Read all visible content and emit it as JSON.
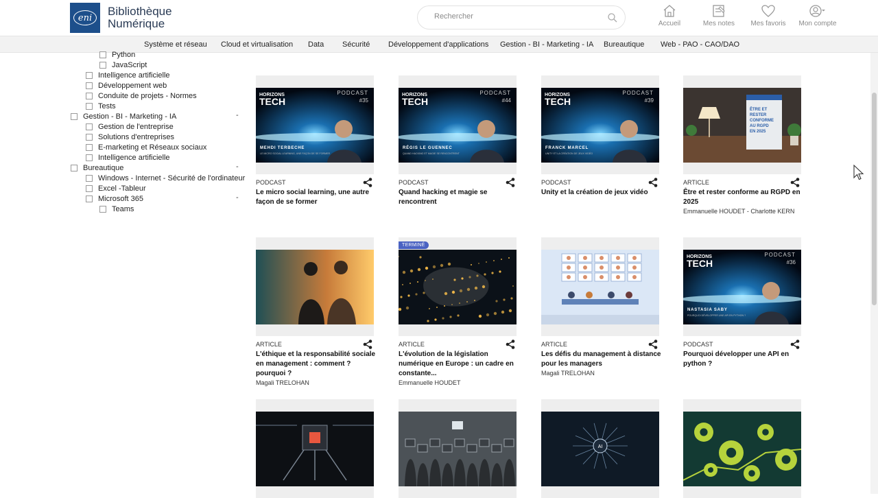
{
  "brand": {
    "logo_text": "eni",
    "line1": "Bibliothèque",
    "line2": "Numérique"
  },
  "search": {
    "placeholder": "Rechercher"
  },
  "nav": [
    {
      "label": "Accueil",
      "icon": "home-icon"
    },
    {
      "label": "Mes notes",
      "icon": "notes-icon"
    },
    {
      "label": "Mes favoris",
      "icon": "heart-icon"
    },
    {
      "label": "Mon compte",
      "icon": "account-icon"
    }
  ],
  "categories": [
    "Système et réseau",
    "Cloud et virtualisation",
    "Data",
    "Sécurité",
    "Développement d'applications",
    "Gestion - BI - Marketing - IA",
    "Bureautique",
    "Web - PAO - CAO/DAO"
  ],
  "sidebar": {
    "items": [
      {
        "label": "Python",
        "level": 2,
        "collapsible": false
      },
      {
        "label": "JavaScript",
        "level": 2,
        "collapsible": false
      },
      {
        "label": "Intelligence artificielle",
        "level": 1,
        "collapsible": false
      },
      {
        "label": "Développement web",
        "level": 1,
        "collapsible": false
      },
      {
        "label": "Conduite de projets - Normes",
        "level": 1,
        "collapsible": false
      },
      {
        "label": "Tests",
        "level": 1,
        "collapsible": false
      },
      {
        "label": "Gestion - BI - Marketing - IA",
        "level": 0,
        "collapsible": true
      },
      {
        "label": "Gestion de l'entreprise",
        "level": 1,
        "collapsible": false
      },
      {
        "label": "Solutions d'entreprises",
        "level": 1,
        "collapsible": false
      },
      {
        "label": "E-marketing et Réseaux sociaux",
        "level": 1,
        "collapsible": false
      },
      {
        "label": "Intelligence artificielle",
        "level": 1,
        "collapsible": false
      },
      {
        "label": "Bureautique",
        "level": 0,
        "collapsible": true
      },
      {
        "label": "Windows - Internet - Sécurité de l'ordinateur",
        "level": 1,
        "collapsible": false
      },
      {
        "label": "Excel -Tableur",
        "level": 1,
        "collapsible": false
      },
      {
        "label": "Microsoft 365",
        "level": 1,
        "collapsible": true
      },
      {
        "label": "Teams",
        "level": 2,
        "collapsible": false
      }
    ],
    "collapse_symbol": "-"
  },
  "cards": [
    {
      "type": "PODCAST",
      "title": "Le micro social learning, une autre façon de se former",
      "author": "",
      "badge": "",
      "thumb": "podcast",
      "episode": "#35",
      "guest": "MEHDI TERBECHE",
      "subtitle": "LE MICRO SOCIAL LEARNING, UNE FAÇON DE SE FORMER"
    },
    {
      "type": "PODCAST",
      "title": "Quand hacking et magie se rencontrent",
      "author": "",
      "badge": "",
      "thumb": "podcast",
      "episode": "#44",
      "guest": "RÉGIS LE GUENNEC",
      "subtitle": "QUAND HACKING ET MAGIE SE RENCONTRENT"
    },
    {
      "type": "PODCAST",
      "title": "Unity et la création de jeux vidéo",
      "author": "",
      "badge": "",
      "thumb": "podcast",
      "episode": "#39",
      "guest": "FRANCK MARCEL",
      "subtitle": "UNITY ET LA CRÉATION DE JEUX VIDÉO"
    },
    {
      "type": "ARTICLE",
      "title": "Être et rester conforme au RGPD en 2025",
      "author": "Emmanuelle HOUDET - Charlotte KERN",
      "badge": "",
      "thumb": "rgpd",
      "book_text": "ÊTRE ET RESTER CONFORME AU RGPD EN 2025"
    },
    {
      "type": "ARTICLE",
      "title": "L'éthique et la responsabilité sociale en management : comment ? pourquoi ?",
      "author": "Magali TRELOHAN",
      "badge": "",
      "thumb": "sunset"
    },
    {
      "type": "ARTICLE",
      "title": "L'évolution de la législation numérique en Europe : un cadre en constante...",
      "author": "Emmanuelle HOUDET",
      "badge": "TERMINÉ",
      "thumb": "europe"
    },
    {
      "type": "ARTICLE",
      "title": "Les défis du management à distance pour les managers",
      "author": "Magali TRELOHAN",
      "badge": "",
      "thumb": "remote"
    },
    {
      "type": "PODCAST",
      "title": "Pourquoi développer une API en python ?",
      "author": "",
      "badge": "",
      "thumb": "podcast",
      "episode": "#36",
      "guest": "NASTASIA SABY",
      "subtitle": "POURQUOI DÉVELOPPER UNE API EN PYTHON ?"
    },
    {
      "type": "",
      "title": "",
      "author": "",
      "badge": "",
      "thumb": "chip"
    },
    {
      "type": "",
      "title": "",
      "author": "",
      "badge": "",
      "thumb": "robots"
    },
    {
      "type": "",
      "title": "",
      "author": "",
      "badge": "",
      "thumb": "ai",
      "chip_text": "AI"
    },
    {
      "type": "",
      "title": "",
      "author": "",
      "badge": "",
      "thumb": "gears"
    }
  ],
  "podcast_brand": {
    "line1": "HORIZONS",
    "line2": "TECH",
    "label": "PODCAST"
  },
  "colors": {
    "logo_bg": "#1d4f8b",
    "badge": "#4a62c2",
    "catbar_bg": "#f2f2f2"
  }
}
